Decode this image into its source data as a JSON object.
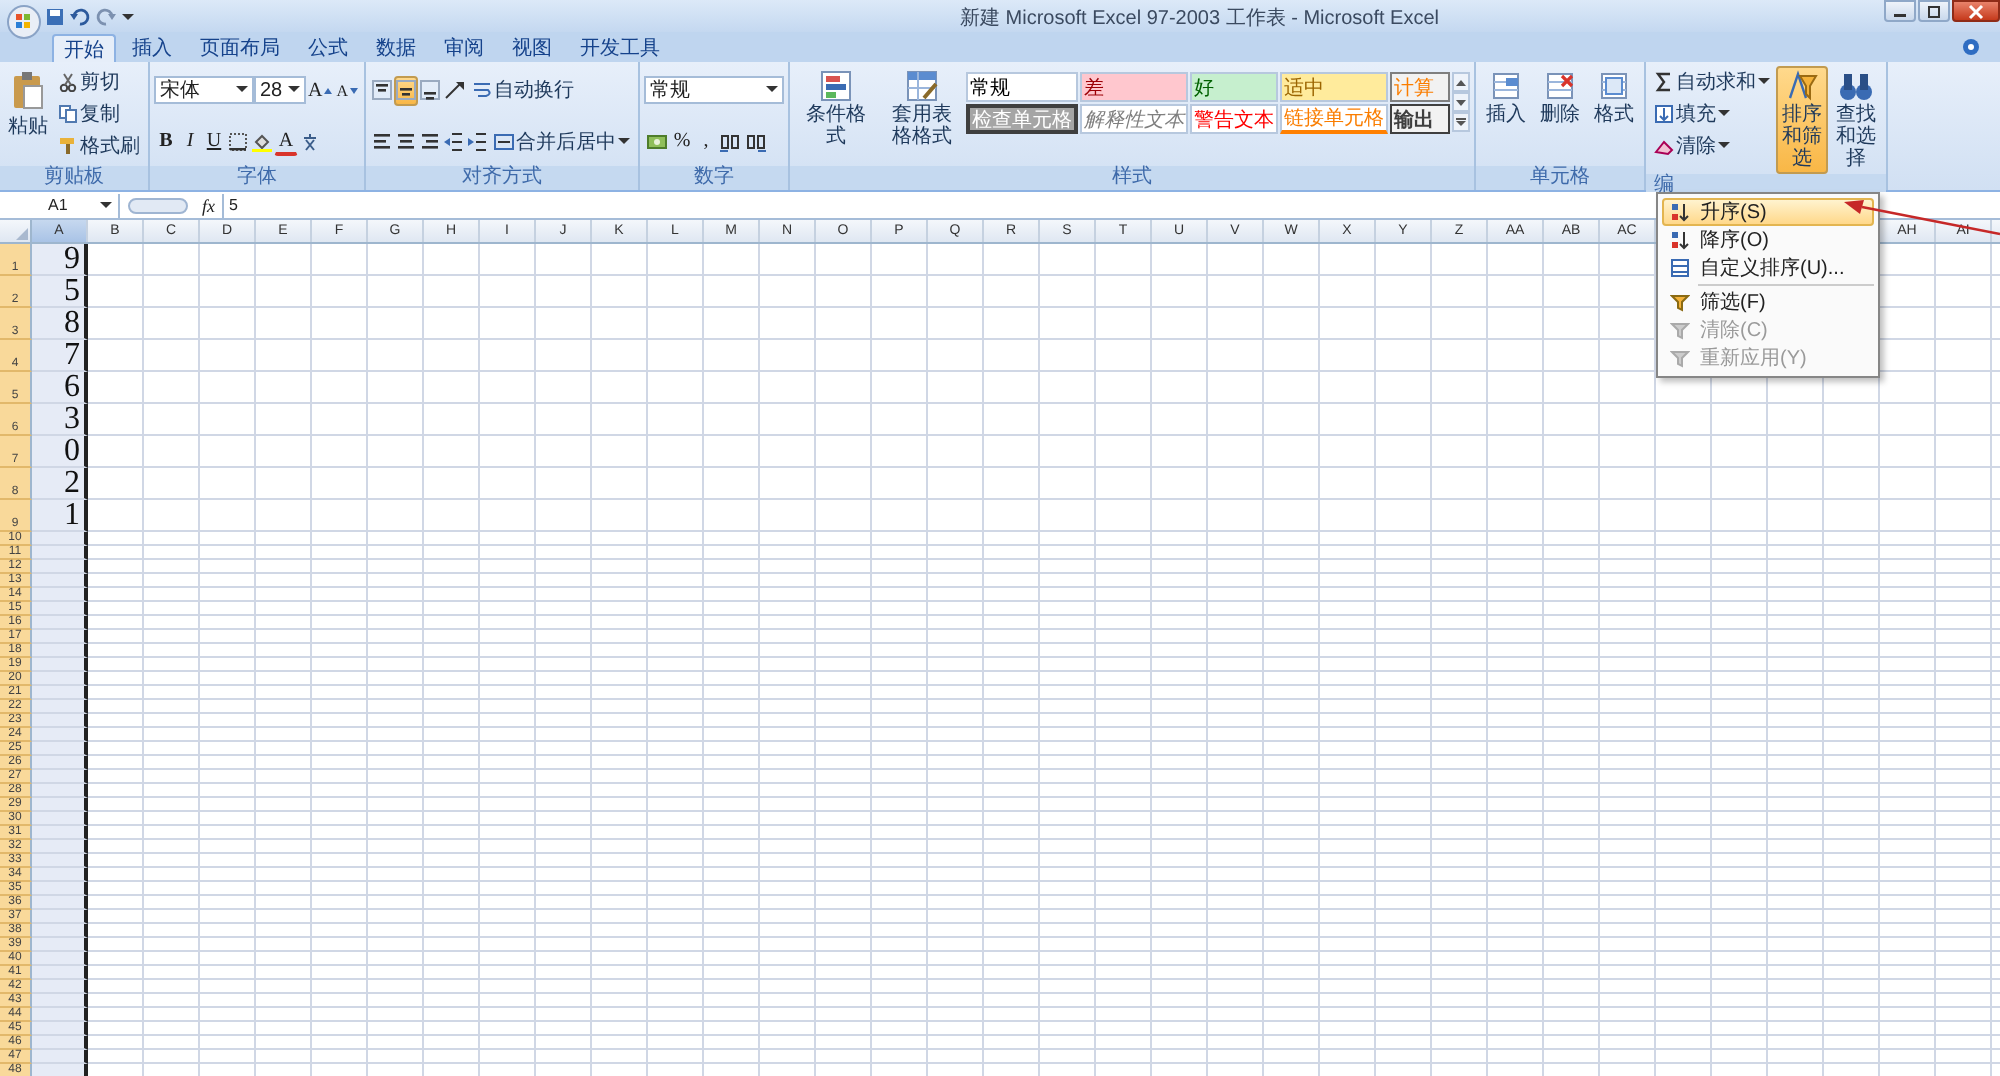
{
  "window": {
    "title": "新建 Microsoft Excel 97-2003 工作表 - Microsoft Excel"
  },
  "tabs": [
    {
      "label": "开始",
      "selected": true
    },
    {
      "label": "插入",
      "selected": false
    },
    {
      "label": "页面布局",
      "selected": false
    },
    {
      "label": "公式",
      "selected": false
    },
    {
      "label": "数据",
      "selected": false
    },
    {
      "label": "审阅",
      "selected": false
    },
    {
      "label": "视图",
      "selected": false
    },
    {
      "label": "开发工具",
      "selected": false
    }
  ],
  "clipboard": {
    "label": "剪贴板",
    "paste": "粘贴",
    "items": [
      "剪切",
      "复制",
      "格式刷"
    ]
  },
  "font": {
    "label": "字体",
    "name": "宋体",
    "size": "28",
    "grow": "A",
    "shrink": "A",
    "styles": [
      "B",
      "I",
      "U"
    ],
    "color_letter": "A"
  },
  "alignment": {
    "label": "对齐方式",
    "wrap": "自动换行",
    "merge": "合并后居中"
  },
  "number": {
    "label": "数字",
    "format": "常规",
    "symbols": [
      "%",
      ","
    ]
  },
  "styles": {
    "label": "样式",
    "buttons": [
      "条件格式",
      "套用表格格式"
    ],
    "cells": [
      {
        "text": "常规",
        "kind": "normal"
      },
      {
        "text": "差",
        "kind": "bad"
      },
      {
        "text": "好",
        "kind": "good"
      },
      {
        "text": "适中",
        "kind": "neutral"
      },
      {
        "text": "计算",
        "kind": "calculation"
      },
      {
        "text": "检查单元格",
        "kind": "check"
      },
      {
        "text": "解释性文本",
        "kind": "explanatory"
      },
      {
        "text": "警告文本",
        "kind": "warning"
      },
      {
        "text": "链接单元格",
        "kind": "linked"
      },
      {
        "text": "输出",
        "kind": "output"
      }
    ]
  },
  "cells_group": {
    "label": "单元格",
    "buttons": [
      "插入",
      "删除",
      "格式"
    ]
  },
  "editing": {
    "label": "编",
    "items": [
      "自动求和",
      "填充",
      "清除"
    ],
    "buttons": [
      {
        "label": "排序和筛选",
        "selected": true
      },
      {
        "label": "查找和选择",
        "selected": false
      }
    ]
  },
  "sort_menu": {
    "items": [
      {
        "label": "升序(S)",
        "selected": true,
        "disabled": false
      },
      {
        "label": "降序(O)",
        "selected": false,
        "disabled": false
      },
      {
        "label": "自定义排序(U)...",
        "selected": false,
        "disabled": false
      },
      {
        "label": "筛选(F)",
        "selected": false,
        "disabled": false
      },
      {
        "label": "清除(C)",
        "selected": false,
        "disabled": true
      },
      {
        "label": "重新应用(Y)",
        "selected": false,
        "disabled": true
      }
    ]
  },
  "formula_bar": {
    "name_box": "A1",
    "fx": "fx",
    "value": "5"
  },
  "sheet": {
    "columns": [
      {
        "label": "A",
        "selected": true
      },
      {
        "label": "B",
        "selected": false
      },
      {
        "label": "C",
        "selected": false
      },
      {
        "label": "D",
        "selected": false
      },
      {
        "label": "E",
        "selected": false
      },
      {
        "label": "F",
        "selected": false
      },
      {
        "label": "G",
        "selected": false
      },
      {
        "label": "H",
        "selected": false
      },
      {
        "label": "I",
        "selected": false
      },
      {
        "label": "J",
        "selected": false
      },
      {
        "label": "K",
        "selected": false
      },
      {
        "label": "L",
        "selected": false
      },
      {
        "label": "M",
        "selected": false
      },
      {
        "label": "N",
        "selected": false
      },
      {
        "label": "O",
        "selected": false
      },
      {
        "label": "P",
        "selected": false
      },
      {
        "label": "Q",
        "selected": false
      },
      {
        "label": "R",
        "selected": false
      },
      {
        "label": "S",
        "selected": false
      },
      {
        "label": "T",
        "selected": false
      },
      {
        "label": "U",
        "selected": false
      },
      {
        "label": "V",
        "selected": false
      },
      {
        "label": "W",
        "selected": false
      },
      {
        "label": "X",
        "selected": false
      },
      {
        "label": "Y",
        "selected": false
      },
      {
        "label": "Z",
        "selected": false
      },
      {
        "label": "AA",
        "selected": false
      },
      {
        "label": "AB",
        "selected": false
      },
      {
        "label": "AC",
        "selected": false
      },
      {},
      {},
      {},
      {},
      {
        "label": "AH",
        "selected": false
      },
      {
        "label": "AI",
        "selected": false
      }
    ],
    "rows": [
      {
        "label": "1",
        "value": "9"
      },
      {
        "label": "2",
        "value": "5"
      },
      {
        "label": "3",
        "value": "8"
      },
      {
        "label": "4",
        "value": "7"
      },
      {
        "label": "5",
        "value": "6"
      },
      {
        "label": "6",
        "value": "3"
      },
      {
        "label": "7",
        "value": "0"
      },
      {
        "label": "8",
        "value": "2"
      },
      {
        "label": "9",
        "value": "1"
      },
      {
        "label": "10"
      },
      {
        "label": "11"
      },
      {
        "label": "12"
      },
      {
        "label": "13"
      },
      {
        "label": "14"
      },
      {
        "label": "15"
      },
      {
        "label": "16"
      },
      {
        "label": "17"
      },
      {
        "label": "18"
      },
      {
        "label": "19"
      },
      {
        "label": "20"
      },
      {
        "label": "21"
      },
      {
        "label": "22"
      },
      {
        "label": "23"
      },
      {
        "label": "24"
      },
      {
        "label": "25"
      },
      {
        "label": "26"
      },
      {
        "label": "27"
      },
      {
        "label": "28"
      },
      {
        "label": "29"
      },
      {
        "label": "30"
      },
      {
        "label": "31"
      },
      {
        "label": "32"
      },
      {
        "label": "33"
      },
      {
        "label": "34"
      },
      {
        "label": "35"
      },
      {
        "label": "36"
      },
      {
        "label": "37"
      },
      {
        "label": "38"
      },
      {
        "label": "39"
      },
      {
        "label": "40"
      },
      {
        "label": "41"
      },
      {
        "label": "42"
      },
      {
        "label": "43"
      },
      {
        "label": "44"
      },
      {
        "label": "45"
      },
      {
        "label": "46"
      },
      {
        "label": "47"
      },
      {
        "label": "48"
      }
    ]
  }
}
